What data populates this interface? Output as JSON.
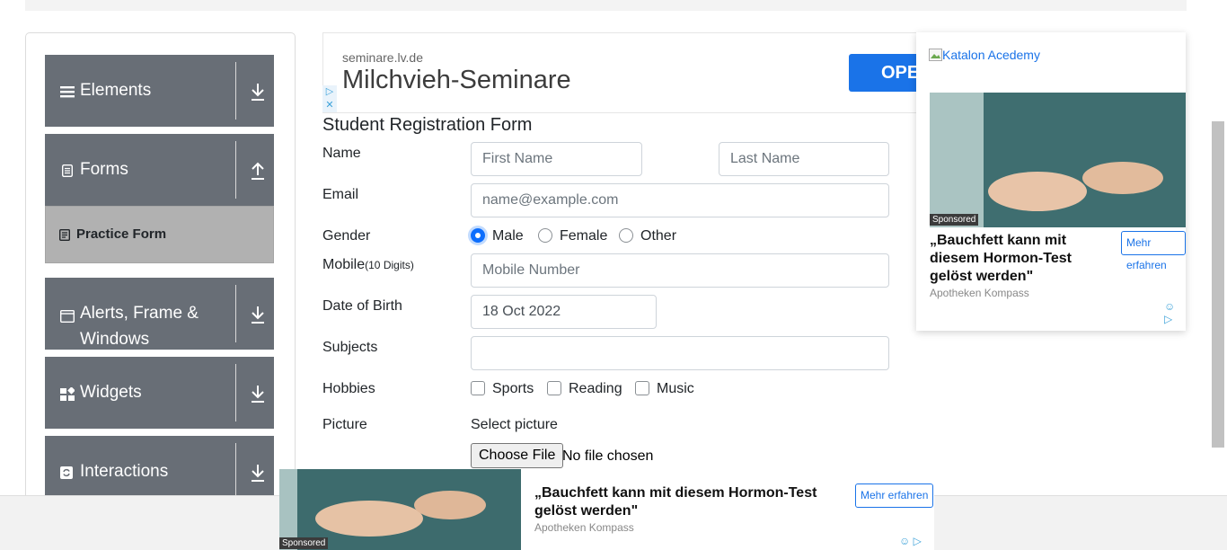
{
  "sidebar": {
    "groups": [
      {
        "label": "Elements",
        "icon": "hamburger-icon",
        "arrow": "download-arrow-icon"
      },
      {
        "label": "Forms",
        "icon": "document-icon",
        "arrow": "upload-arrow-icon"
      },
      {
        "label_line1": "Alerts, Frame &",
        "label_line2": "Windows",
        "icon": "window-icon",
        "arrow": "download-arrow-icon"
      },
      {
        "label": "Widgets",
        "icon": "widgets-icon",
        "arrow": "download-arrow-icon"
      },
      {
        "label": "Interactions",
        "icon": "sync-icon",
        "arrow": "download-arrow-icon"
      }
    ],
    "active_item": "Practice Form"
  },
  "ad_top": {
    "domain": "seminare.lv.de",
    "headline": "Milchvieh-Seminare",
    "button": "OPEN"
  },
  "form": {
    "title": "Student Registration Form",
    "name_label": "Name",
    "first_name_placeholder": "First Name",
    "last_name_placeholder": "Last Name",
    "email_label": "Email",
    "email_placeholder": "name@example.com",
    "gender_label": "Gender",
    "gender_options": [
      "Male",
      "Female",
      "Other"
    ],
    "gender_selected": "Male",
    "mobile_label": "Mobile",
    "mobile_hint": "(10 Digits)",
    "mobile_placeholder": "Mobile Number",
    "dob_label": "Date of Birth",
    "dob_value": "18 Oct 2022",
    "subjects_label": "Subjects",
    "hobbies_label": "Hobbies",
    "hobbies": [
      "Sports",
      "Reading",
      "Music"
    ],
    "picture_label": "Picture",
    "select_picture": "Select picture",
    "choose_file": "Choose File",
    "no_file": "No file chosen"
  },
  "ad_right": {
    "broken_image_alt": "Katalon Acedemy",
    "sponsored": "Sponsored",
    "headline": "„Bauchfett kann mit diesem Hormon-Test gelöst werden\"",
    "source": "Apotheken Kompass",
    "button": "Mehr erfahren"
  },
  "ad_bottom": {
    "sponsored": "Sponsored",
    "headline": "„Bauchfett kann mit diesem Hormon-Test gelöst werden\"",
    "source": "Apotheken Kompass",
    "button": "Mehr erfahren"
  },
  "colors": {
    "sidebar_group": "#686e76",
    "active_item": "#b1b1b1",
    "accent": "#0d6efd",
    "ad_blue": "#1a73e8"
  }
}
